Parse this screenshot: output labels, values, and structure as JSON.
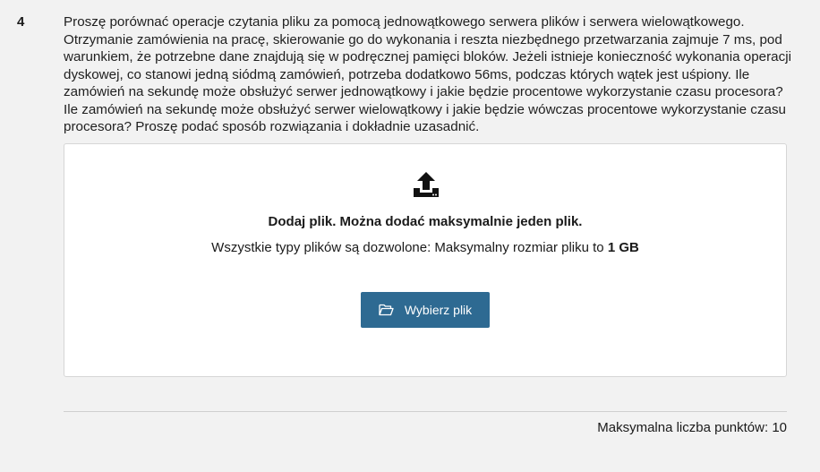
{
  "question": {
    "number": "4",
    "text": "Proszę porównać operacje czytania pliku za pomocą jednowątkowego serwera plików i serwera wielowątkowego. Otrzymanie zamówienia na pracę, skierowanie go do wykonania i reszta niezbędnego przetwarzania zajmuje 7 ms, pod warunkiem, że potrzebne dane znajdują się w podręcznej pamięci bloków. Jeżeli istnieje konieczność wykonania operacji dyskowej, co stanowi jedną siódmą zamówień, potrzeba dodatkowo 56ms, podczas których wątek jest uśpiony. Ile zamówień na sekundę może obsłużyć serwer jednowątkowy i jakie będzie procentowe wykorzystanie czasu procesora? Ile zamówień na sekundę może obsłużyć serwer wielowątkowy i jakie będzie wówczas procentowe wykorzystanie czasu procesora?  Proszę podać sposób rozwiązania i dokładnie uzasadnić."
  },
  "upload": {
    "icon": "upload-icon",
    "title": "Dodaj plik. Można dodać maksymalnie jeden plik.",
    "info_prefix": "Wszystkie typy plików są dozwolone: Maksymalny rozmiar pliku to ",
    "info_size": "1 GB",
    "button_label": "Wybierz plik",
    "button_icon": "folder-open-icon",
    "button_color": "#2e6a92"
  },
  "footer": {
    "max_points": "Maksymalna liczba punktów: 10"
  }
}
